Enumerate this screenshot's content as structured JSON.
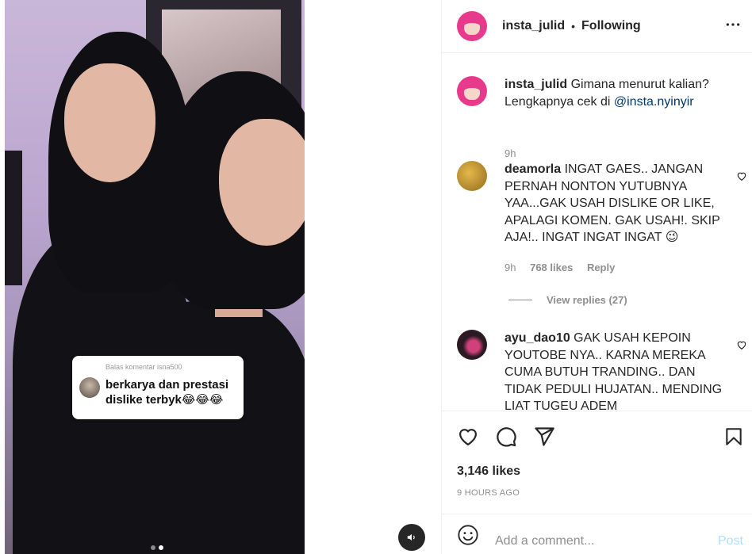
{
  "media": {
    "overlay_comment": {
      "header": "Balas komentar isna500",
      "text": "berkarya dan prestasi dislike terbyk😂😂😂"
    },
    "carousel": {
      "count": 2,
      "active_index": 1
    },
    "mute_icon": "speaker-icon"
  },
  "post": {
    "username": "insta_julid",
    "separator": "•",
    "follow_status": "Following",
    "more_icon": "more-options-icon"
  },
  "caption": {
    "username": "insta_julid",
    "text": "Gimana menurut kalian? Lengkapnya cek di ",
    "mention": "@insta.nyinyir",
    "time": "9h"
  },
  "comments": [
    {
      "username": "deamorla",
      "text": "INGAT GAES.. JANGAN PERNAH NONTON YUTUBNYA YAA...GAK USAH DISLIKE OR LIKE, APALAGI KOMEN. GAK USAH!. SKIP AJA!.. INGAT INGAT INGAT 😉",
      "time": "9h",
      "likes": "768 likes",
      "reply": "Reply",
      "view_replies": "View replies (27)"
    },
    {
      "username": "ayu_dao10",
      "text": "GAK USAH KEPOIN YOUTOBE NYA.. KARNA MEREKA CUMA BUTUH TRANDING.. DAN TIDAK PEDULI HUJATAN.. MENDING LIAT TUGEU ADEM"
    }
  ],
  "actions": {
    "like_icon": "heart-icon",
    "comment_icon": "comment-icon",
    "share_icon": "share-icon",
    "save_icon": "bookmark-icon",
    "likes": "3,146 likes",
    "time_ago": "9 HOURS AGO"
  },
  "add_comment": {
    "placeholder": "Add a comment...",
    "post_label": "Post"
  },
  "colors": {
    "link": "#00376b",
    "muted": "#8e8e8e",
    "post_disabled": "#b2dffc",
    "avatar_brand": "#e83a8c"
  }
}
